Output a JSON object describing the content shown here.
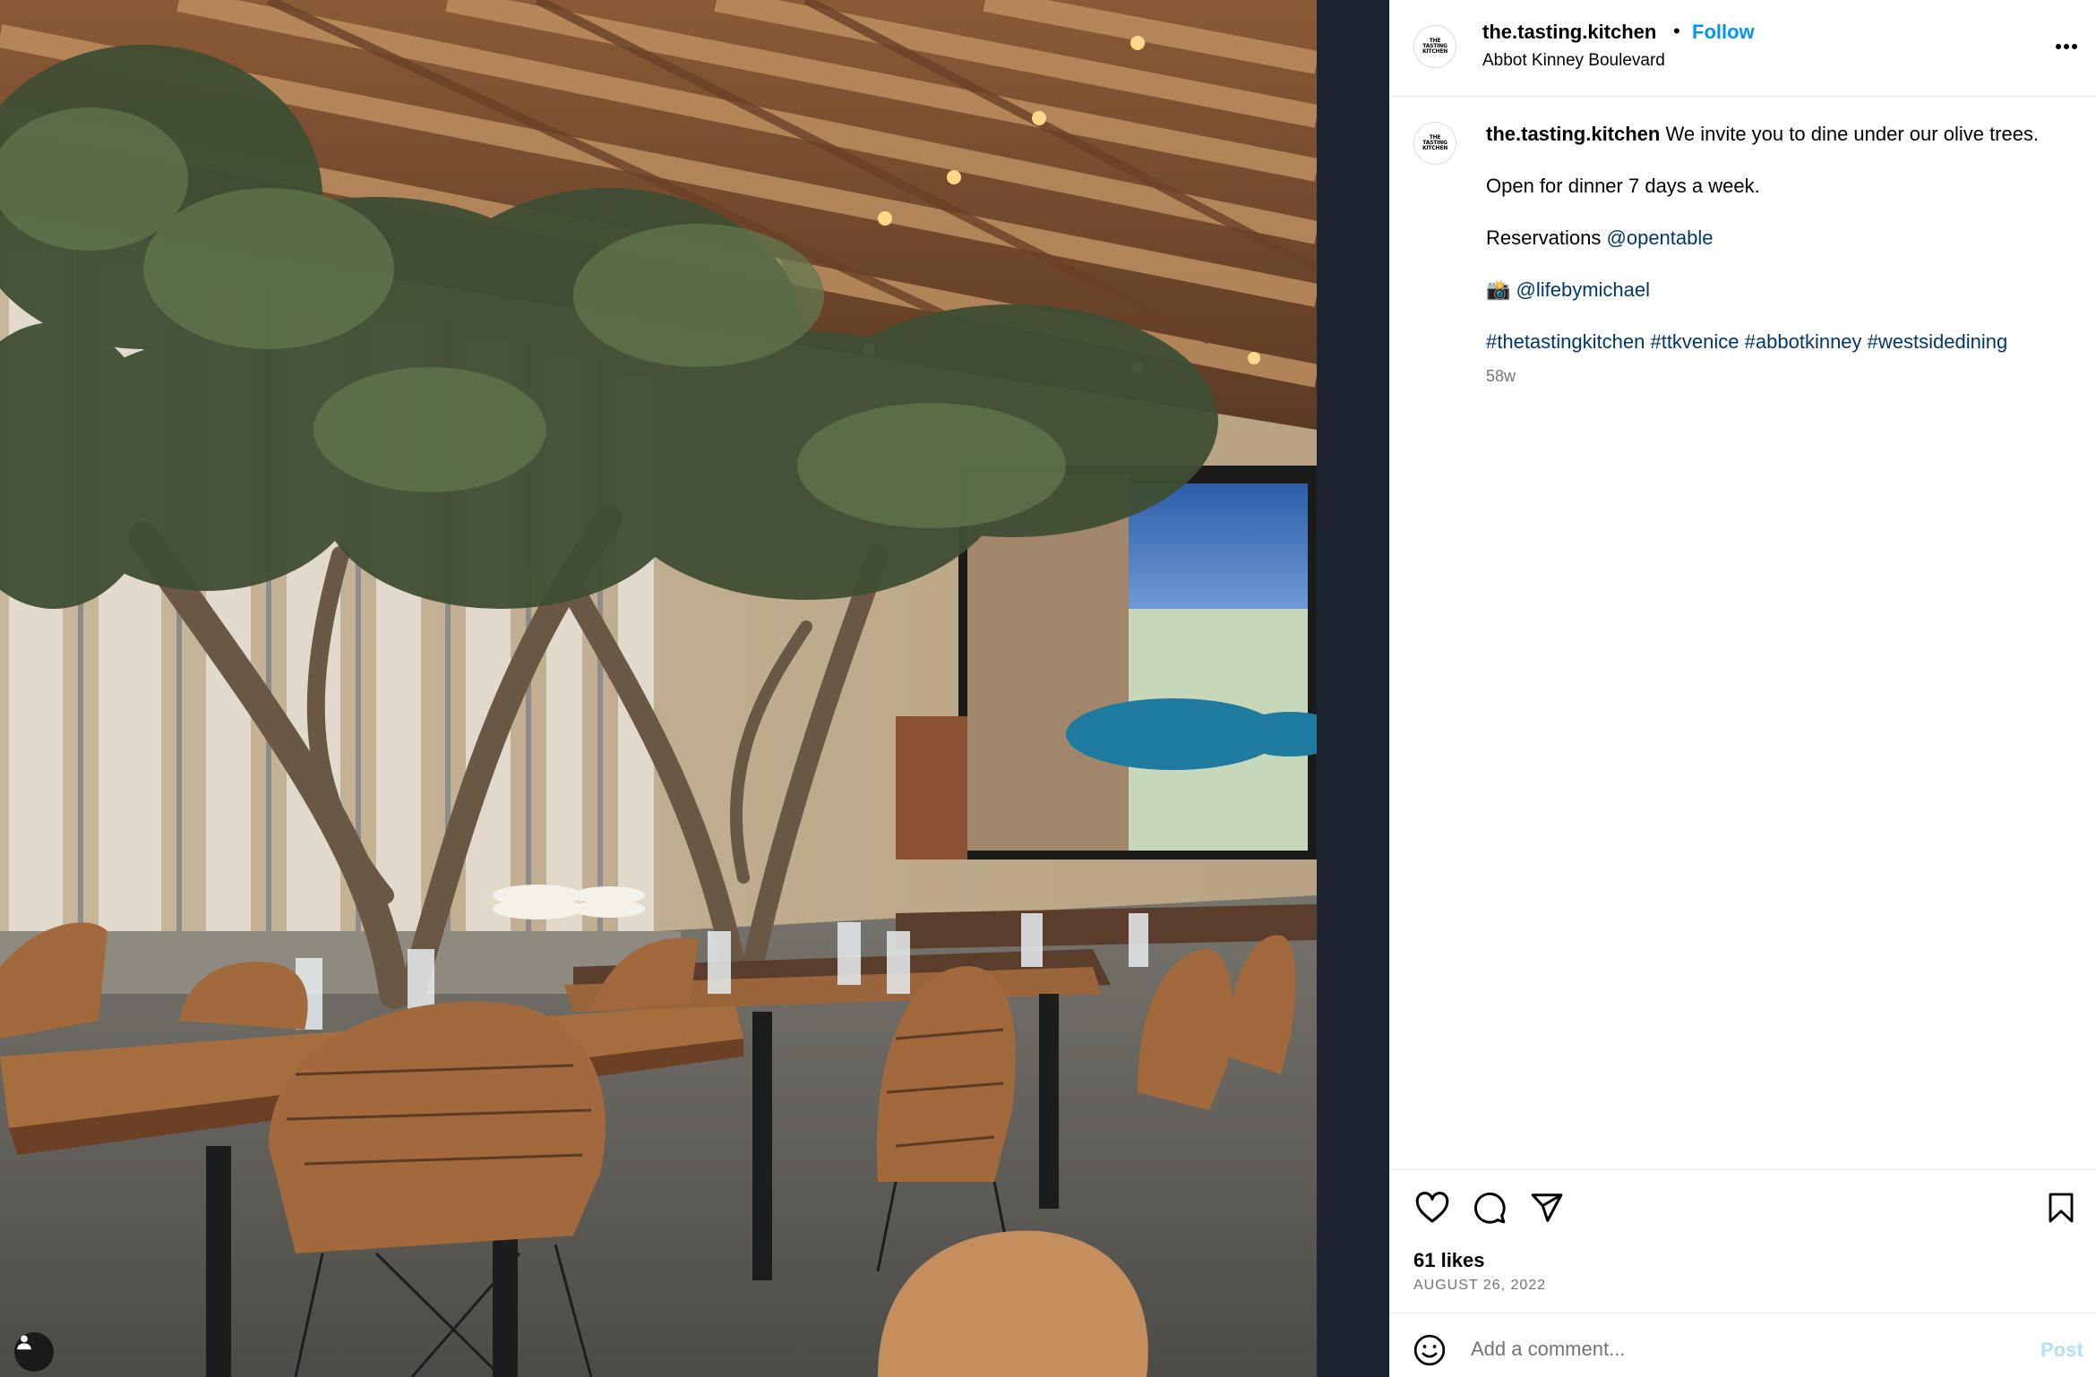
{
  "photo": {
    "alt": "Restaurant patio with olive trees, wooden tables and wire chairs",
    "user_tag_icon": "person-icon"
  },
  "header": {
    "avatar_text": "THE\nTASTING\nKITCHEN",
    "username": "the.tasting.kitchen",
    "separator": "•",
    "follow_label": "Follow",
    "location": "Abbot Kinney Boulevard",
    "more_icon": "more-horizontal-icon"
  },
  "caption": {
    "username": "the.tasting.kitchen",
    "text_line1": "We invite you to dine under our olive trees.",
    "text_line2": "Open for dinner 7 days a week.",
    "reservations_label": "Reservations",
    "reservations_link": "@opentable",
    "camera_emoji": "📸",
    "photographer_link": "@lifebymichael",
    "hashtags": [
      "#thetastingkitchen",
      "#ttkvenice",
      "#abbotkinney",
      "#westsidedining"
    ],
    "time_ago": "58w"
  },
  "actions": {
    "like_icon": "heart-icon",
    "comment_icon": "comment-icon",
    "share_icon": "share-icon",
    "save_icon": "bookmark-icon",
    "likes": "61 likes",
    "date": "AUGUST 26, 2022"
  },
  "comment_box": {
    "emoji_icon": "emoji-icon",
    "placeholder": "Add a comment...",
    "post_label": "Post"
  },
  "colors": {
    "link": "#00376b",
    "follow": "#0095f6",
    "post_disabled": "#b2dffc",
    "muted": "#737373",
    "divider": "#efefef"
  }
}
